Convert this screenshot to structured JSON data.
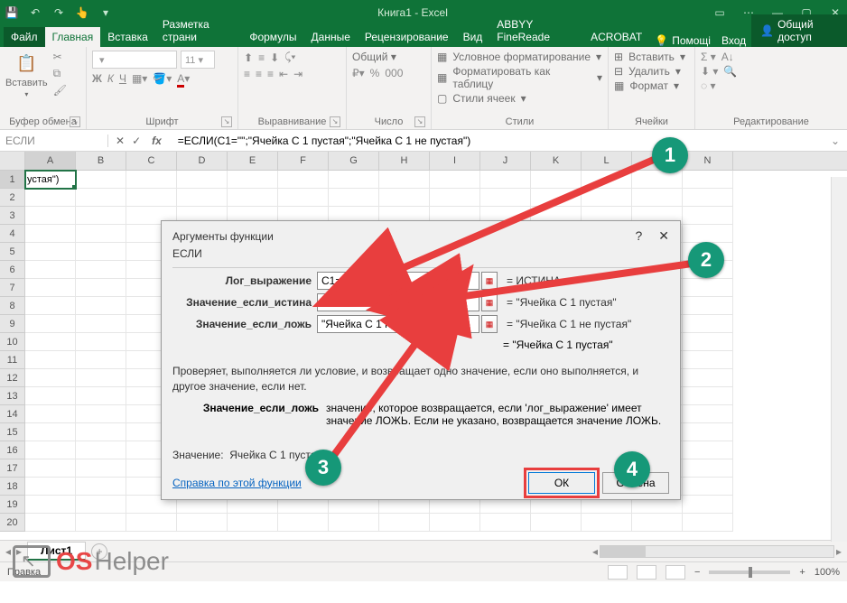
{
  "title": "Книга1 - Excel",
  "qat": {
    "save": "💾",
    "undo": "↶",
    "redo": "↷",
    "touch": "👆",
    "more": "▾"
  },
  "wincontrols": {
    "ribbonopts": "▭",
    "help": "⋯",
    "min": "—",
    "max": "▢",
    "close": "✕"
  },
  "tabs": {
    "file": "Файл",
    "home": "Главная",
    "insert": "Вставка",
    "layout": "Разметка страни",
    "formulas": "Формулы",
    "data": "Данные",
    "review": "Рецензирование",
    "view": "Вид",
    "abbyy": "ABBYY FineReade",
    "acrobat": "ACROBAT",
    "help": "Помощі",
    "login": "Вход",
    "share": "Общий доступ"
  },
  "ribbon": {
    "clipboard": {
      "paste": "Вставить",
      "label": "Буфер обмена"
    },
    "font": {
      "label": "Шрифт",
      "b": "Ж",
      "i": "К",
      "u": "Ч"
    },
    "alignment": {
      "label": "Выравнивание"
    },
    "number": {
      "format": "Общий",
      "label": "Число"
    },
    "styles": {
      "cond": "Условное форматирование",
      "table": "Форматировать как таблицу",
      "cell": "Стили ячеек",
      "label": "Стили"
    },
    "cells": {
      "insert": "Вставить",
      "delete": "Удалить",
      "format": "Формат",
      "label": "Ячейки"
    },
    "editing": {
      "label": "Редактирование"
    }
  },
  "namebox": "ЕСЛИ",
  "fx": {
    "cancel": "✕",
    "enter": "✓",
    "fx": "fx"
  },
  "formula": "=ЕСЛИ(C1=\"\";\"Ячейка С 1 пустая\";\"Ячейка С 1 не пустая\")",
  "columns": [
    "A",
    "B",
    "C",
    "D",
    "E",
    "F",
    "G",
    "H",
    "I",
    "J",
    "K",
    "L",
    "M",
    "N"
  ],
  "rows": [
    "1",
    "2",
    "3",
    "4",
    "5",
    "6",
    "7",
    "8",
    "9",
    "10",
    "11",
    "12",
    "13",
    "14",
    "15",
    "16",
    "17",
    "18",
    "19",
    "20"
  ],
  "cellA1": "устая\")",
  "dialog": {
    "title": "Аргументы функции",
    "help": "?",
    "close": "✕",
    "fnname": "ЕСЛИ",
    "fields": {
      "f1label": "Лог_выражение",
      "f1val": "C1=\"\"",
      "f1res": "=  ИСТИНА",
      "f2label": "Значение_если_истина",
      "f2val": "\"Ячейка С 1 пустая\"",
      "f2res": "=  \"Ячейка С 1 пустая\"",
      "f3label": "Значение_если_ложь",
      "f3val": "\"Ячейка С 1 не пустая\"",
      "f3res": "=  \"Ячейка С 1 не пустая\""
    },
    "overall": "=  \"Ячейка С 1 пустая\"",
    "desc1": "Проверяет, выполняется ли условие, и возвращает одно значение, если оно выполняется, и другое значение, если нет.",
    "desc2label": "Значение_если_ложь",
    "desc2text": "значение, которое возвращается, если 'лог_выражение' имеет значение ЛОЖЬ. Если не указано, возвращается значение ЛОЖЬ.",
    "resultlabel": "Значение:",
    "resultval": "Ячейка С 1 пустая",
    "link": "Справка по этой функции",
    "ok": "ОК",
    "cancel": "Отмена"
  },
  "sheet": {
    "tab1": "Лист1",
    "add": "+"
  },
  "status": {
    "mode": "Правка",
    "zoom": "100%",
    "minus": "−",
    "plus": "+"
  },
  "badges": {
    "b1": "1",
    "b2": "2",
    "b3": "3",
    "b4": "4"
  },
  "watermark": {
    "t1": "OS",
    "t2": "Helper"
  }
}
